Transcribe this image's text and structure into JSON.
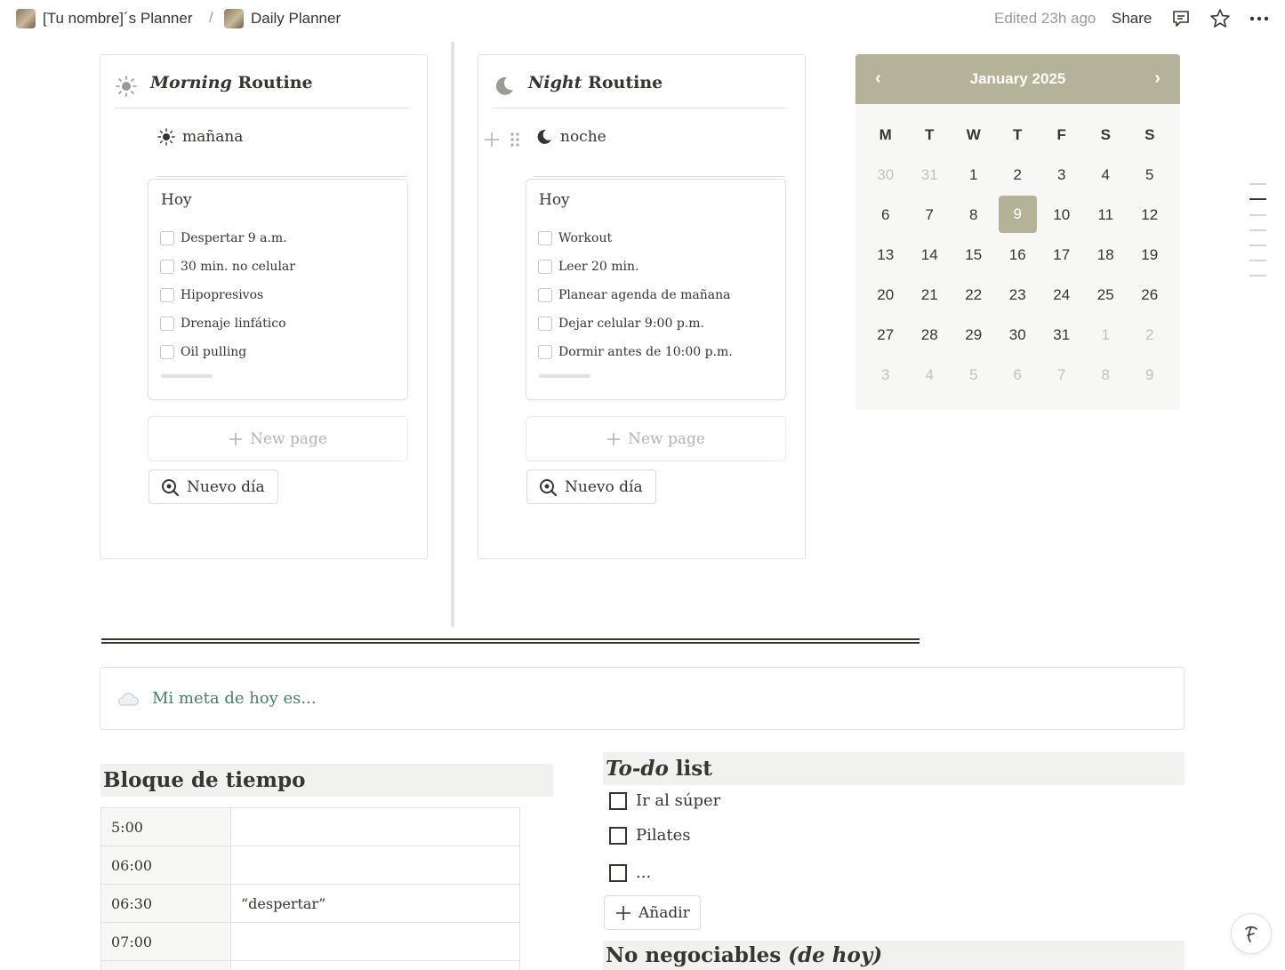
{
  "breadcrumb": {
    "workspace": "[Tu nombre]´s Planner",
    "separator": "/",
    "page": "Daily Planner"
  },
  "topbar": {
    "edited": "Edited 23h ago",
    "share": "Share",
    "icons": [
      "comment-icon",
      "star-icon",
      "more-icon"
    ]
  },
  "morning": {
    "title_italic": "Morning",
    "title_rest": " Routine",
    "icon": "sun-icon",
    "view_label": "mañana",
    "card_title": "Hoy",
    "items": [
      "Despertar 9 a.m.",
      "30 min. no celular",
      "Hipopresivos",
      "Drenaje linfático",
      "Oil pulling"
    ],
    "new_page": "New page",
    "button": "Nuevo día"
  },
  "night": {
    "title_italic": "Night",
    "title_rest": " Routine",
    "icon": "moon-icon",
    "view_label": "noche",
    "card_title": "Hoy",
    "items": [
      "Workout",
      "Leer 20 min.",
      "Planear agenda de mañana",
      "Dejar celular 9:00 p.m.",
      "Dormir antes de 10:00 p.m."
    ],
    "new_page": "New page",
    "button": "Nuevo día"
  },
  "calendar": {
    "month": "January 2025",
    "accent": "#b5b397",
    "weekdays": [
      "M",
      "T",
      "W",
      "T",
      "F",
      "S",
      "S"
    ],
    "selected_day": "9",
    "days": [
      [
        "30",
        "31",
        "1",
        "2",
        "3",
        "4",
        "5"
      ],
      [
        "6",
        "7",
        "8",
        "9",
        "10",
        "11",
        "12"
      ],
      [
        "13",
        "14",
        "15",
        "16",
        "17",
        "18",
        "19"
      ],
      [
        "20",
        "21",
        "22",
        "23",
        "24",
        "25",
        "26"
      ],
      [
        "27",
        "28",
        "29",
        "30",
        "31",
        "1",
        "2"
      ],
      [
        "3",
        "4",
        "5",
        "6",
        "7",
        "8",
        "9"
      ]
    ],
    "muted": [
      [
        true,
        true,
        false,
        false,
        false,
        false,
        false
      ],
      [
        false,
        false,
        false,
        false,
        false,
        false,
        false
      ],
      [
        false,
        false,
        false,
        false,
        false,
        false,
        false
      ],
      [
        false,
        false,
        false,
        false,
        false,
        false,
        false
      ],
      [
        false,
        false,
        false,
        false,
        false,
        true,
        true
      ],
      [
        true,
        true,
        true,
        true,
        true,
        true,
        true
      ]
    ]
  },
  "goal": {
    "icon": "cloud-icon",
    "text": "Mi meta de hoy es..."
  },
  "time_block": {
    "title": "Bloque de tiempo",
    "rows": [
      {
        "time": "5:00",
        "task": ""
      },
      {
        "time": "06:00",
        "task": ""
      },
      {
        "time": "06:30",
        "task": "“despertar”"
      },
      {
        "time": "07:00",
        "task": ""
      },
      {
        "time": "",
        "task": ""
      }
    ]
  },
  "todo": {
    "title_italic": "To-do",
    "title_rest": " list",
    "items": [
      "Ir al súper",
      "Pilates",
      "..."
    ],
    "add_button": "Añadir"
  },
  "no_negociables": {
    "title_rest": "No negociables ",
    "title_italic": "(de hoy)"
  }
}
